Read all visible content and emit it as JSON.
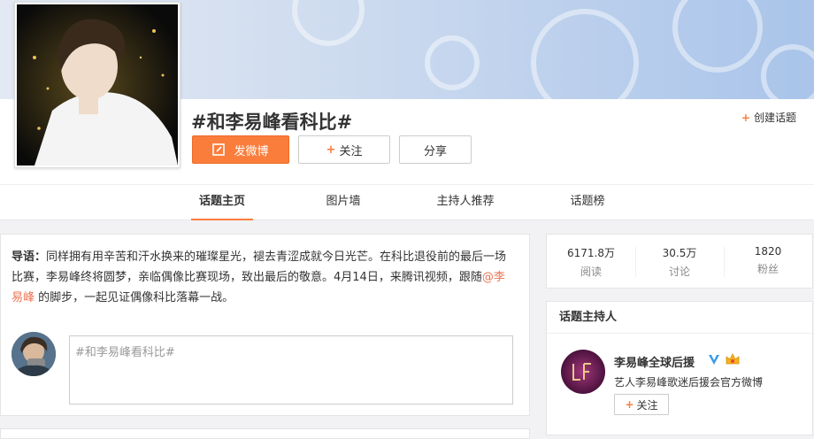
{
  "topic": {
    "title": "#和李易峰看科比#",
    "create_label": "创建话题",
    "post_button": "发微博",
    "follow_button": "关注",
    "share_button": "分享"
  },
  "tabs": [
    {
      "label": "话题主页",
      "active": true
    },
    {
      "label": "图片墙",
      "active": false
    },
    {
      "label": "主持人推荐",
      "active": false
    },
    {
      "label": "话题榜",
      "active": false
    }
  ],
  "intro": {
    "lead": "导语：",
    "text_before": "同样拥有用辛苦和汗水换来的璀璨星光，褪去青涩成就今日光芒。在科比退役前的最后一场比赛，李易峰终将圆梦，亲临偶像比赛现场，致出最后的敬意。4月14日，来腾讯视频，跟随",
    "mention": "@李易峰",
    "text_after": "的脚步，一起见证偶像科比落幕一战。"
  },
  "compose": {
    "placeholder": "#和李易峰看科比#"
  },
  "stats": [
    {
      "value": "6171.8万",
      "label": "阅读"
    },
    {
      "value": "30.5万",
      "label": "讨论"
    },
    {
      "value": "1820",
      "label": "粉丝"
    }
  ],
  "host": {
    "section_title": "话题主持人",
    "name": "李易峰全球后援",
    "description": "艺人李易峰歌迷后援会官方微博",
    "follow_label": "关注"
  },
  "colors": {
    "accent": "#fa7d3c",
    "mention": "#eb7350",
    "verified": "#3b9ce8"
  }
}
